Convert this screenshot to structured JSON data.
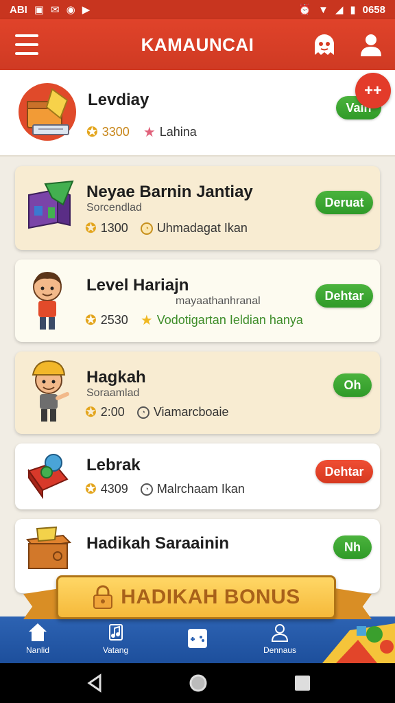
{
  "status_bar": {
    "left_text": "ABI",
    "time": "0658",
    "icons": [
      "media-icon",
      "notification-icon",
      "message-icon",
      "play-icon",
      "alarm-icon",
      "wifi-icon",
      "signal-icon",
      "battery-icon"
    ]
  },
  "app_bar": {
    "title": "KAMAUNCAI",
    "icons": [
      "menu-icon",
      "ghost-icon",
      "user-icon"
    ]
  },
  "top_card": {
    "title": "Levdiay",
    "points": "3300",
    "note": "Lahina",
    "button": "Vain",
    "badge": "++"
  },
  "items": [
    {
      "title": "Neyae Barnin Jantiay",
      "subtitle": "Sorcendlad",
      "points": "1300",
      "note": "Uhmadagat Ikan",
      "button": "Deruat",
      "button_color": "#3a9f2d",
      "icon": "gift-box-icon"
    },
    {
      "title": "Level Hariajn",
      "subtitle": "mayaathanhranal",
      "points": "2530",
      "note": "Vodotigartan Ieldian hanya",
      "note_color": "#3d8c28",
      "button": "Dehtar",
      "button_color": "#3a9f2d",
      "icon": "kid-character-icon"
    },
    {
      "title": "Hagkah",
      "subtitle": "Soraamlad",
      "points": "2:00",
      "note": "Viamarcboaie",
      "button": "Oh",
      "button_color": "#3a9f2d",
      "icon": "explorer-character-icon"
    },
    {
      "title": "Lebrak",
      "points": "4309",
      "note": "Malrchaam Ikan",
      "button": "Dehtar",
      "button_color": "#e23f27",
      "icon": "pin-tray-icon"
    },
    {
      "title": "Hadikah Saraainin",
      "button": "Nh",
      "button_color": "#3a9f2d",
      "icon": "treasure-crate-icon"
    }
  ],
  "banner": {
    "text": "HADIKAH BONUS",
    "icon": "lock-icon"
  },
  "bottom_nav": [
    {
      "label": "Nanlid",
      "icon": "home-icon"
    },
    {
      "label": "Vatang",
      "icon": "music-icon"
    },
    {
      "label": "",
      "icon": "gamepad-icon"
    },
    {
      "label": "Dennaus",
      "icon": "profile-icon"
    }
  ],
  "system_nav": [
    "back-icon",
    "home-circle-icon",
    "recents-icon"
  ]
}
